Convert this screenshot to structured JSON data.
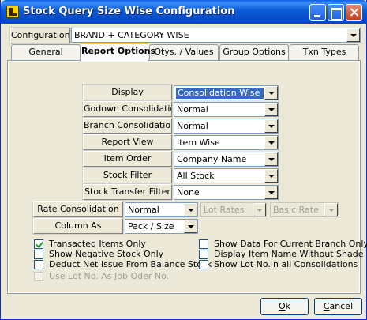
{
  "window": {
    "title": "Stock Query Size Wise Configuration"
  },
  "configuration": {
    "label": "Configuration",
    "value": "BRAND + CATEGORY WISE"
  },
  "tabs": [
    {
      "label": "General"
    },
    {
      "label": "Report Options"
    },
    {
      "label": "Qtys. / Values"
    },
    {
      "label": "Group Options"
    },
    {
      "label": "Txn Types"
    }
  ],
  "options": [
    {
      "label": "Display",
      "value": "Consolidation Wise"
    },
    {
      "label": "Godown Consolidation",
      "value": "Normal"
    },
    {
      "label": "Branch Consolidation",
      "value": "Normal"
    },
    {
      "label": "Report View",
      "value": "Item Wise"
    },
    {
      "label": "Item Order",
      "value": "Company Name"
    },
    {
      "label": "Stock Filter",
      "value": "All Stock"
    },
    {
      "label": "Stock Transfer Filter",
      "value": "None"
    }
  ],
  "rate": {
    "label": "Rate Consolidation",
    "value": "Normal",
    "lot_rates": "Lot Rates",
    "basic_rate": "Basic Rate"
  },
  "column_as": {
    "label": "Column As",
    "value": "Pack / Size"
  },
  "checkboxes_left": [
    {
      "label": "Transacted Items Only",
      "checked": true,
      "enabled": true
    },
    {
      "label": "Show Negative Stock Only",
      "checked": false,
      "enabled": true
    },
    {
      "label": "Deduct Net Issue From Balance Stock",
      "checked": false,
      "enabled": true
    },
    {
      "label": "Use Lot No. As Job Oder No.",
      "checked": false,
      "enabled": false
    }
  ],
  "checkboxes_right": [
    {
      "label": "Show Data For Current Branch Only",
      "checked": false,
      "enabled": true
    },
    {
      "label": "Display Item Name Without Shade",
      "checked": false,
      "enabled": true
    },
    {
      "label": "Show Lot No.in all Consolidations",
      "checked": false,
      "enabled": true
    }
  ],
  "buttons": {
    "ok_first": "O",
    "ok_rest": "k",
    "cancel_first": "C",
    "cancel_rest": "ancel"
  }
}
